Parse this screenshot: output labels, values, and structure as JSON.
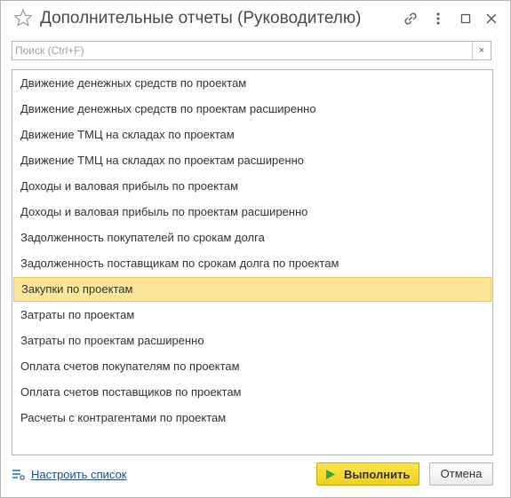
{
  "window": {
    "title": "Дополнительные отчеты (Руководителю)"
  },
  "search": {
    "placeholder": "Поиск (Ctrl+F)",
    "value": "",
    "clear_label": "×"
  },
  "reports": [
    {
      "label": "Движение денежных средств по проектам",
      "selected": false
    },
    {
      "label": "Движение денежных средств по проектам расширенно",
      "selected": false
    },
    {
      "label": "Движение ТМЦ на складах по проектам",
      "selected": false
    },
    {
      "label": "Движение ТМЦ на складах по проектам расширенно",
      "selected": false
    },
    {
      "label": "Доходы и валовая прибыль по проектам",
      "selected": false
    },
    {
      "label": "Доходы и валовая прибыль по проектам расширенно",
      "selected": false
    },
    {
      "label": "Задолженность покупателей по срокам долга",
      "selected": false
    },
    {
      "label": "Задолженность поставщикам по срокам долга по проектам",
      "selected": false
    },
    {
      "label": "Закупки по проектам",
      "selected": true
    },
    {
      "label": "Затраты по проектам",
      "selected": false
    },
    {
      "label": "Затраты по проектам расширенно",
      "selected": false
    },
    {
      "label": "Оплата счетов покупателям по проектам",
      "selected": false
    },
    {
      "label": "Оплата счетов поставщиков по проектам",
      "selected": false
    },
    {
      "label": "Расчеты с контрагентами по проектам",
      "selected": false
    }
  ],
  "footer": {
    "configure_link": "Настроить список",
    "run_button": "Выполнить",
    "cancel_button": "Отмена"
  },
  "colors": {
    "selection_bg": "#fbe79b",
    "selection_border": "#e9c65a",
    "primary_button": "#f5d932",
    "link": "#1c4f8a",
    "play_icon": "#3aa63a"
  }
}
